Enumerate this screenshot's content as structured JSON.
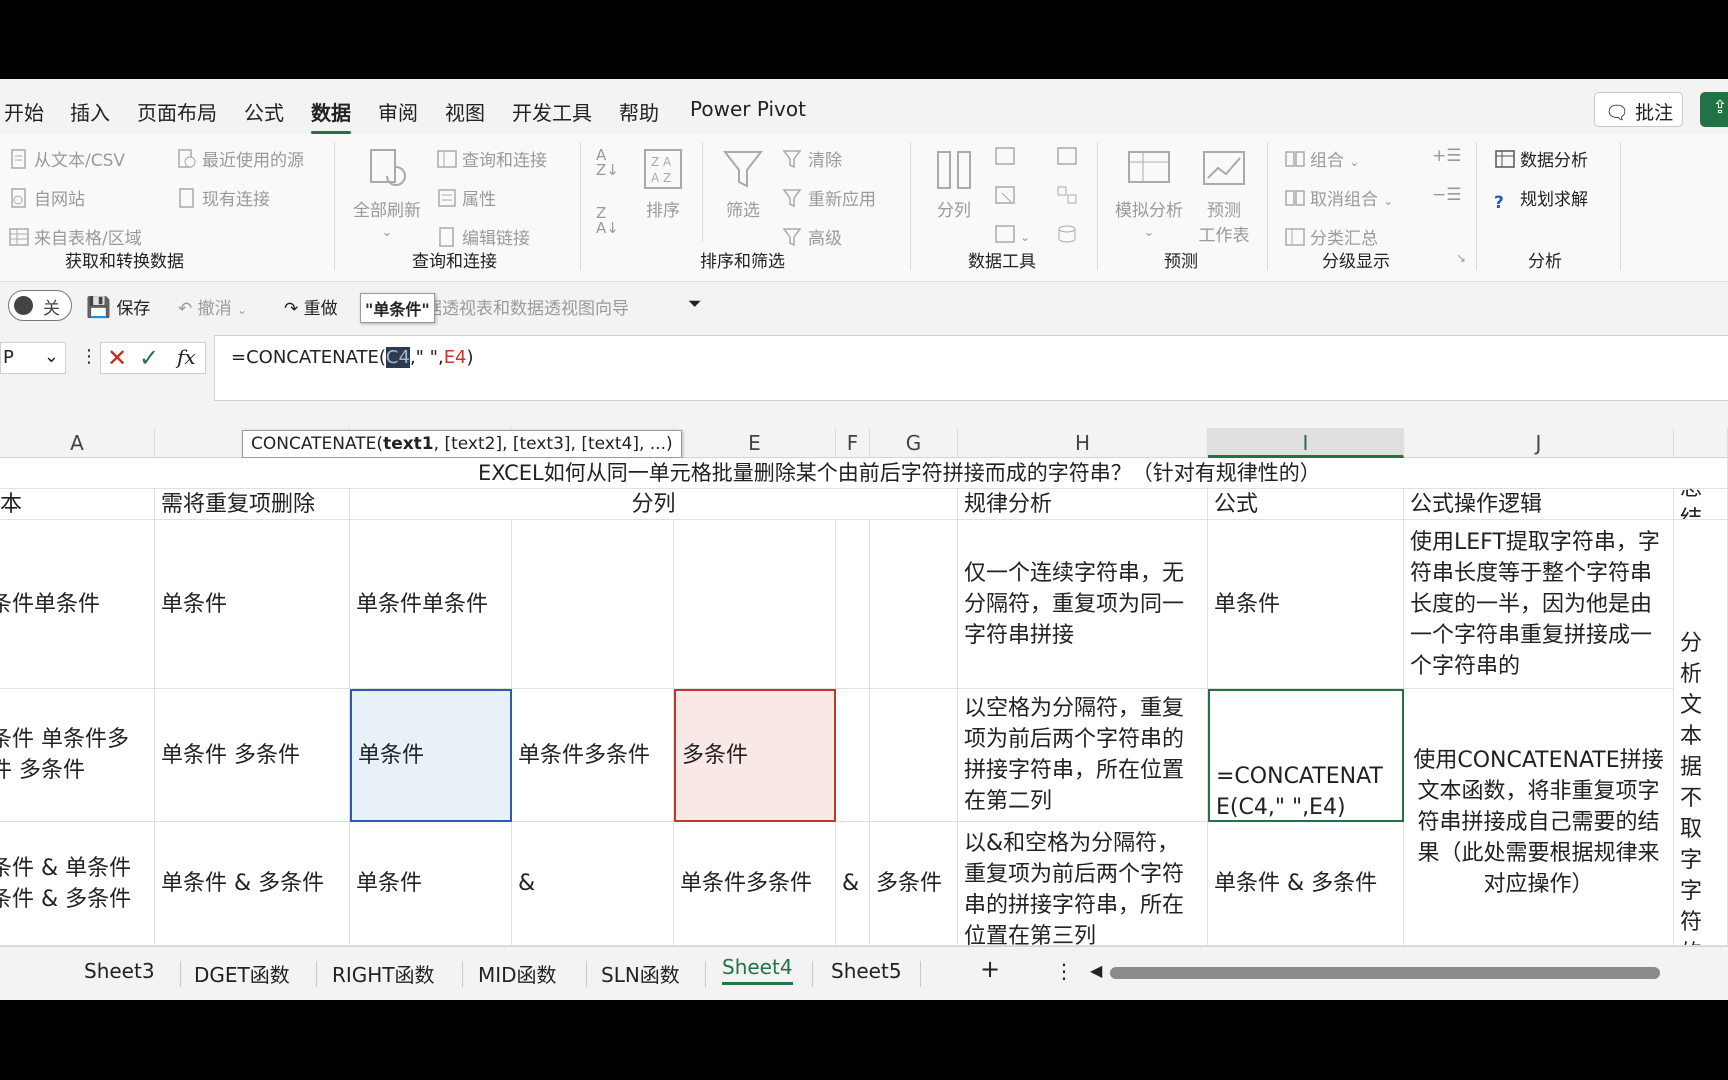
{
  "tabs": [
    "开始",
    "插入",
    "页面布局",
    "公式",
    "数据",
    "审阅",
    "视图",
    "开发工具",
    "帮助",
    "Power Pivot"
  ],
  "active_tab": "数据",
  "comment_label": "批注",
  "ribbon": {
    "get_transform": {
      "items": [
        "从文本/CSV",
        "自网站",
        "来自表格/区域",
        "最近使用的源",
        "现有连接"
      ],
      "label": "获取和转换数据"
    },
    "queries": {
      "refresh_all": "全部刷新",
      "items": [
        "查询和连接",
        "属性",
        "编辑链接"
      ],
      "label": "查询和连接"
    },
    "sort_filter": {
      "sort": "排序",
      "filter": "筛选",
      "items": [
        "清除",
        "重新应用",
        "高级"
      ],
      "label": "排序和筛选"
    },
    "data_tools": {
      "split": "分列",
      "label": "数据工具"
    },
    "forecast": {
      "whatif": "模拟分析",
      "sheet1": "预测",
      "sheet2": "工作表",
      "label": "预测"
    },
    "outline": {
      "items": [
        "组合",
        "取消组合",
        "分类汇总"
      ],
      "label": "分级显示"
    },
    "analysis": {
      "items": [
        "数据分析",
        "规划求解"
      ],
      "label": "分析"
    }
  },
  "qat": {
    "toggle_label": "关",
    "save": "保存",
    "undo": "撤消",
    "redo": "重做",
    "pivot_wizard": "数据透视表和数据透视图向导",
    "tooltip": "\"单条件\""
  },
  "formula_bar": {
    "name_box": "P",
    "fx": "fx",
    "formula_prefix": "=CONCATENATE(",
    "ref_c4": "C4",
    "formula_mid": ",\" \",",
    "ref_e4": "E4",
    "formula_suffix": ")"
  },
  "function_tooltip": {
    "name": "CONCATENATE(",
    "arg1": "text1",
    "rest": ", [text2], [text3], [text4], ...)"
  },
  "columns": [
    "A",
    "E",
    "F",
    "G",
    "H",
    "I",
    "J"
  ],
  "title_row": "EXCEL如何从同一单元格批量删除某个由前后字符拼接而成的字符串？（针对有规律性的）",
  "header_row": {
    "a": "文本",
    "b": "需将重复项删除",
    "split": "分列",
    "analysis": "规律分析",
    "formula": "公式",
    "logic": "公式操作逻辑",
    "summary": "总结"
  },
  "rows": [
    {
      "a": "条件单条件",
      "b": "单条件",
      "c": "单条件单条件",
      "h": "仅一个连续字符串，无分隔符，重复项为同一字符串拼接",
      "i": "单条件",
      "j": "使用LEFT提取字符串，字符串长度等于整个字符串长度的一半，因为他是由一个字符串重复拼接成一个字符串的"
    },
    {
      "a": "条件 单条件多件 多条件",
      "b": "单条件 多条件",
      "c": "单条件",
      "d": "单条件多条件",
      "e": "多条件",
      "h": "以空格为分隔符，重复项为前后两个字符串的拼接字符串，所在位置在第二列",
      "i": "=CONCATENATE(C4,\" \",E4)",
      "j": "使用CONCATENATE拼接文本函数，将非重复项字符串拼接成自己需要的结果（此处需要根据规律来对应操作）"
    },
    {
      "a": "条件 & 单条件条件 & 多条件",
      "b": "单条件 & 多条件",
      "c": "单条件",
      "d": "&",
      "e": "单条件多条件",
      "f": "&",
      "g": "多条件",
      "h": "以&和空格为分隔符，重复项为前后两个字符串的拼接字符串，所在位置在第三列",
      "i": "单条件 & 多条件"
    }
  ],
  "summary_text": "分析文本据不取字字符的字到我",
  "sheets": [
    "Sheet3",
    "DGET函数",
    "RIGHT函数",
    "MID函数",
    "SLN函数",
    "Sheet4",
    "Sheet5"
  ],
  "active_sheet": "Sheet4",
  "add_sheet": "+",
  "more": "⋮",
  "colors": {
    "accent": "#217346",
    "ref_blue": "#2a5db0",
    "ref_red": "#c0392b"
  }
}
